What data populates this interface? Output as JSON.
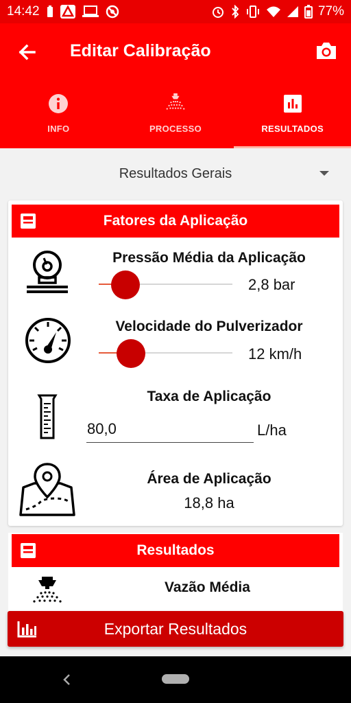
{
  "status_bar": {
    "time": "14:42",
    "battery_percent": "77%",
    "icons": [
      "battery-saver-icon",
      "warning-app-icon",
      "laptop-icon",
      "blocked-icon",
      "alarm-icon",
      "bluetooth-icon",
      "vibrate-icon",
      "wifi-icon",
      "signal-icon",
      "battery-icon"
    ]
  },
  "app_bar": {
    "title": "Editar Calibração",
    "back_icon": "arrow-back-icon",
    "action_icon": "camera-icon"
  },
  "tabs": [
    {
      "label": "INFO",
      "icon": "info-icon",
      "active": false
    },
    {
      "label": "PROCESSO",
      "icon": "sprayer-nozzle-icon",
      "active": false
    },
    {
      "label": "RESULTADOS",
      "icon": "bar-chart-icon",
      "active": true
    }
  ],
  "dropdown": {
    "selected": "Resultados Gerais"
  },
  "fatores": {
    "title": "Fatores da Aplicação",
    "pressao": {
      "title": "Pressão Média da Aplicação",
      "value": "2,8 bar",
      "level": 0.2
    },
    "velocidade": {
      "title": "Velocidade do Pulverizador",
      "value": "12 km/h",
      "level": 0.24
    },
    "taxa": {
      "title": "Taxa de Aplicação",
      "input_value": "80,0",
      "unit": "L/ha"
    },
    "area": {
      "title": "Área de Aplicação",
      "value": "18,8 ha"
    }
  },
  "resultados": {
    "title": "Resultados",
    "vazao": {
      "title": "Vazão Média"
    }
  },
  "export_button": {
    "label": "Exportar Resultados"
  },
  "colors": {
    "status_bar": "#e80000",
    "primary": "#ff0000",
    "slider_thumb": "#c80000",
    "button": "#cc0000"
  }
}
